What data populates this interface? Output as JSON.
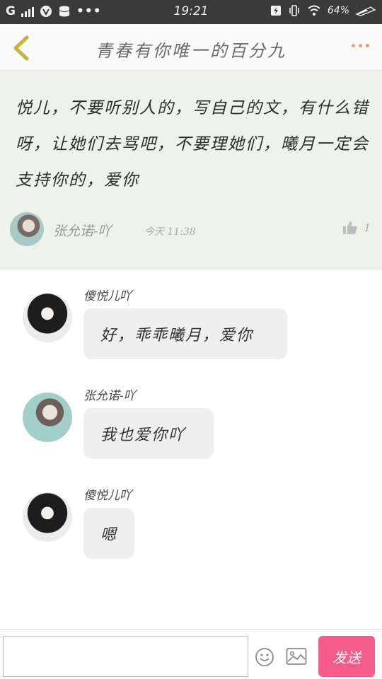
{
  "status_bar": {
    "carrier": "G",
    "time": "19:21",
    "battery": "64%",
    "icons": [
      "signal-icon",
      "vpn-icon",
      "storage-icon",
      "more-dots-icon",
      "battery-saver-icon",
      "vibrate-icon",
      "wifi-icon",
      "battery-icon"
    ]
  },
  "header": {
    "title": "青春有你唯一的百分九",
    "back_icon": "chevron-left-icon",
    "more_icon": "more-dots-icon",
    "accent_color": "#f19a6b"
  },
  "post": {
    "text": "悦儿，不要听别人的，写自己的文，有什么错呀，让她们去骂吧，不要理她们，曦月一定会支持你的，爱你",
    "author": "张允诺-吖",
    "time": "今天 11:38",
    "likes": "1",
    "background": "#eef2ea"
  },
  "comments": [
    {
      "name": "傻悦儿吖",
      "text": "好，乖乖曦月，爱你"
    },
    {
      "name": "张允诺-吖",
      "text": "我也爱你吖"
    },
    {
      "name": "傻悦儿吖",
      "text": "嗯"
    }
  ],
  "composer": {
    "input_value": "",
    "send_label": "发送",
    "send_color": "#f45d8a",
    "emoji_icon": "emoji-icon",
    "image_icon": "image-icon"
  }
}
